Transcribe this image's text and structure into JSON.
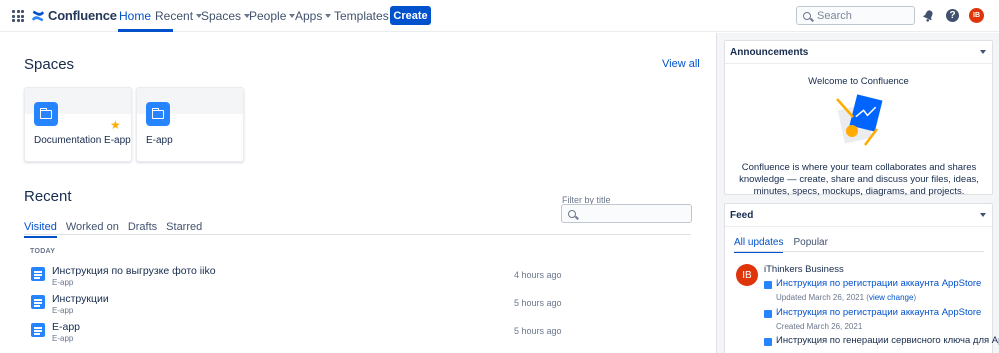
{
  "nav": {
    "logo": "Confluence",
    "items": [
      {
        "label": "Home"
      },
      {
        "label": "Recent"
      },
      {
        "label": "Spaces"
      },
      {
        "label": "People"
      },
      {
        "label": "Apps"
      },
      {
        "label": "Templates"
      }
    ],
    "create_label": "Create",
    "search_placeholder": "Search",
    "help_glyph": "?",
    "avatar_initials": "IB"
  },
  "spaces": {
    "title": "Spaces",
    "view_all": "View all",
    "cards": [
      {
        "name": "Documentation E-app",
        "starred": true
      },
      {
        "name": "E-app",
        "starred": false
      }
    ]
  },
  "recent": {
    "title": "Recent",
    "tabs": [
      "Visited",
      "Worked on",
      "Drafts",
      "Starred"
    ],
    "active_tab": "Visited",
    "filter_label": "Filter by title",
    "group_label": "TODAY",
    "items": [
      {
        "title": "Инструкция по выгрузке фото iiko",
        "space": "E-app",
        "time": "4 hours ago"
      },
      {
        "title": "Инструкции",
        "space": "E-app",
        "time": "5 hours ago"
      },
      {
        "title": "E-app",
        "space": "E-app",
        "time": "5 hours ago"
      }
    ]
  },
  "announcements": {
    "title": "Announcements",
    "welcome": "Welcome to Confluence",
    "text": "Confluence is where your team collaborates and shares knowledge — create, share and discuss your files, ideas, minutes, specs, mockups, diagrams, and projects."
  },
  "feed": {
    "title": "Feed",
    "tabs": [
      "All updates",
      "Popular"
    ],
    "user_initials": "IB",
    "user_name": "iThinkers Business",
    "items": [
      {
        "title": "Инструкция по регистрации аккаунта AppStore",
        "meta": "Updated March 26, 2021 (",
        "meta_link": "view change",
        "meta_end": ")"
      },
      {
        "title": "Инструкция по регистрации аккаунта AppStore",
        "meta": "Created March 26, 2021"
      },
      {
        "title": "Инструкция по генерации сервисного ключа для AppStore"
      }
    ]
  },
  "colors": {
    "accent": "#0052cc",
    "brand_icon": "#2684ff",
    "avatar": "#de350b",
    "star": "#ffab00"
  }
}
